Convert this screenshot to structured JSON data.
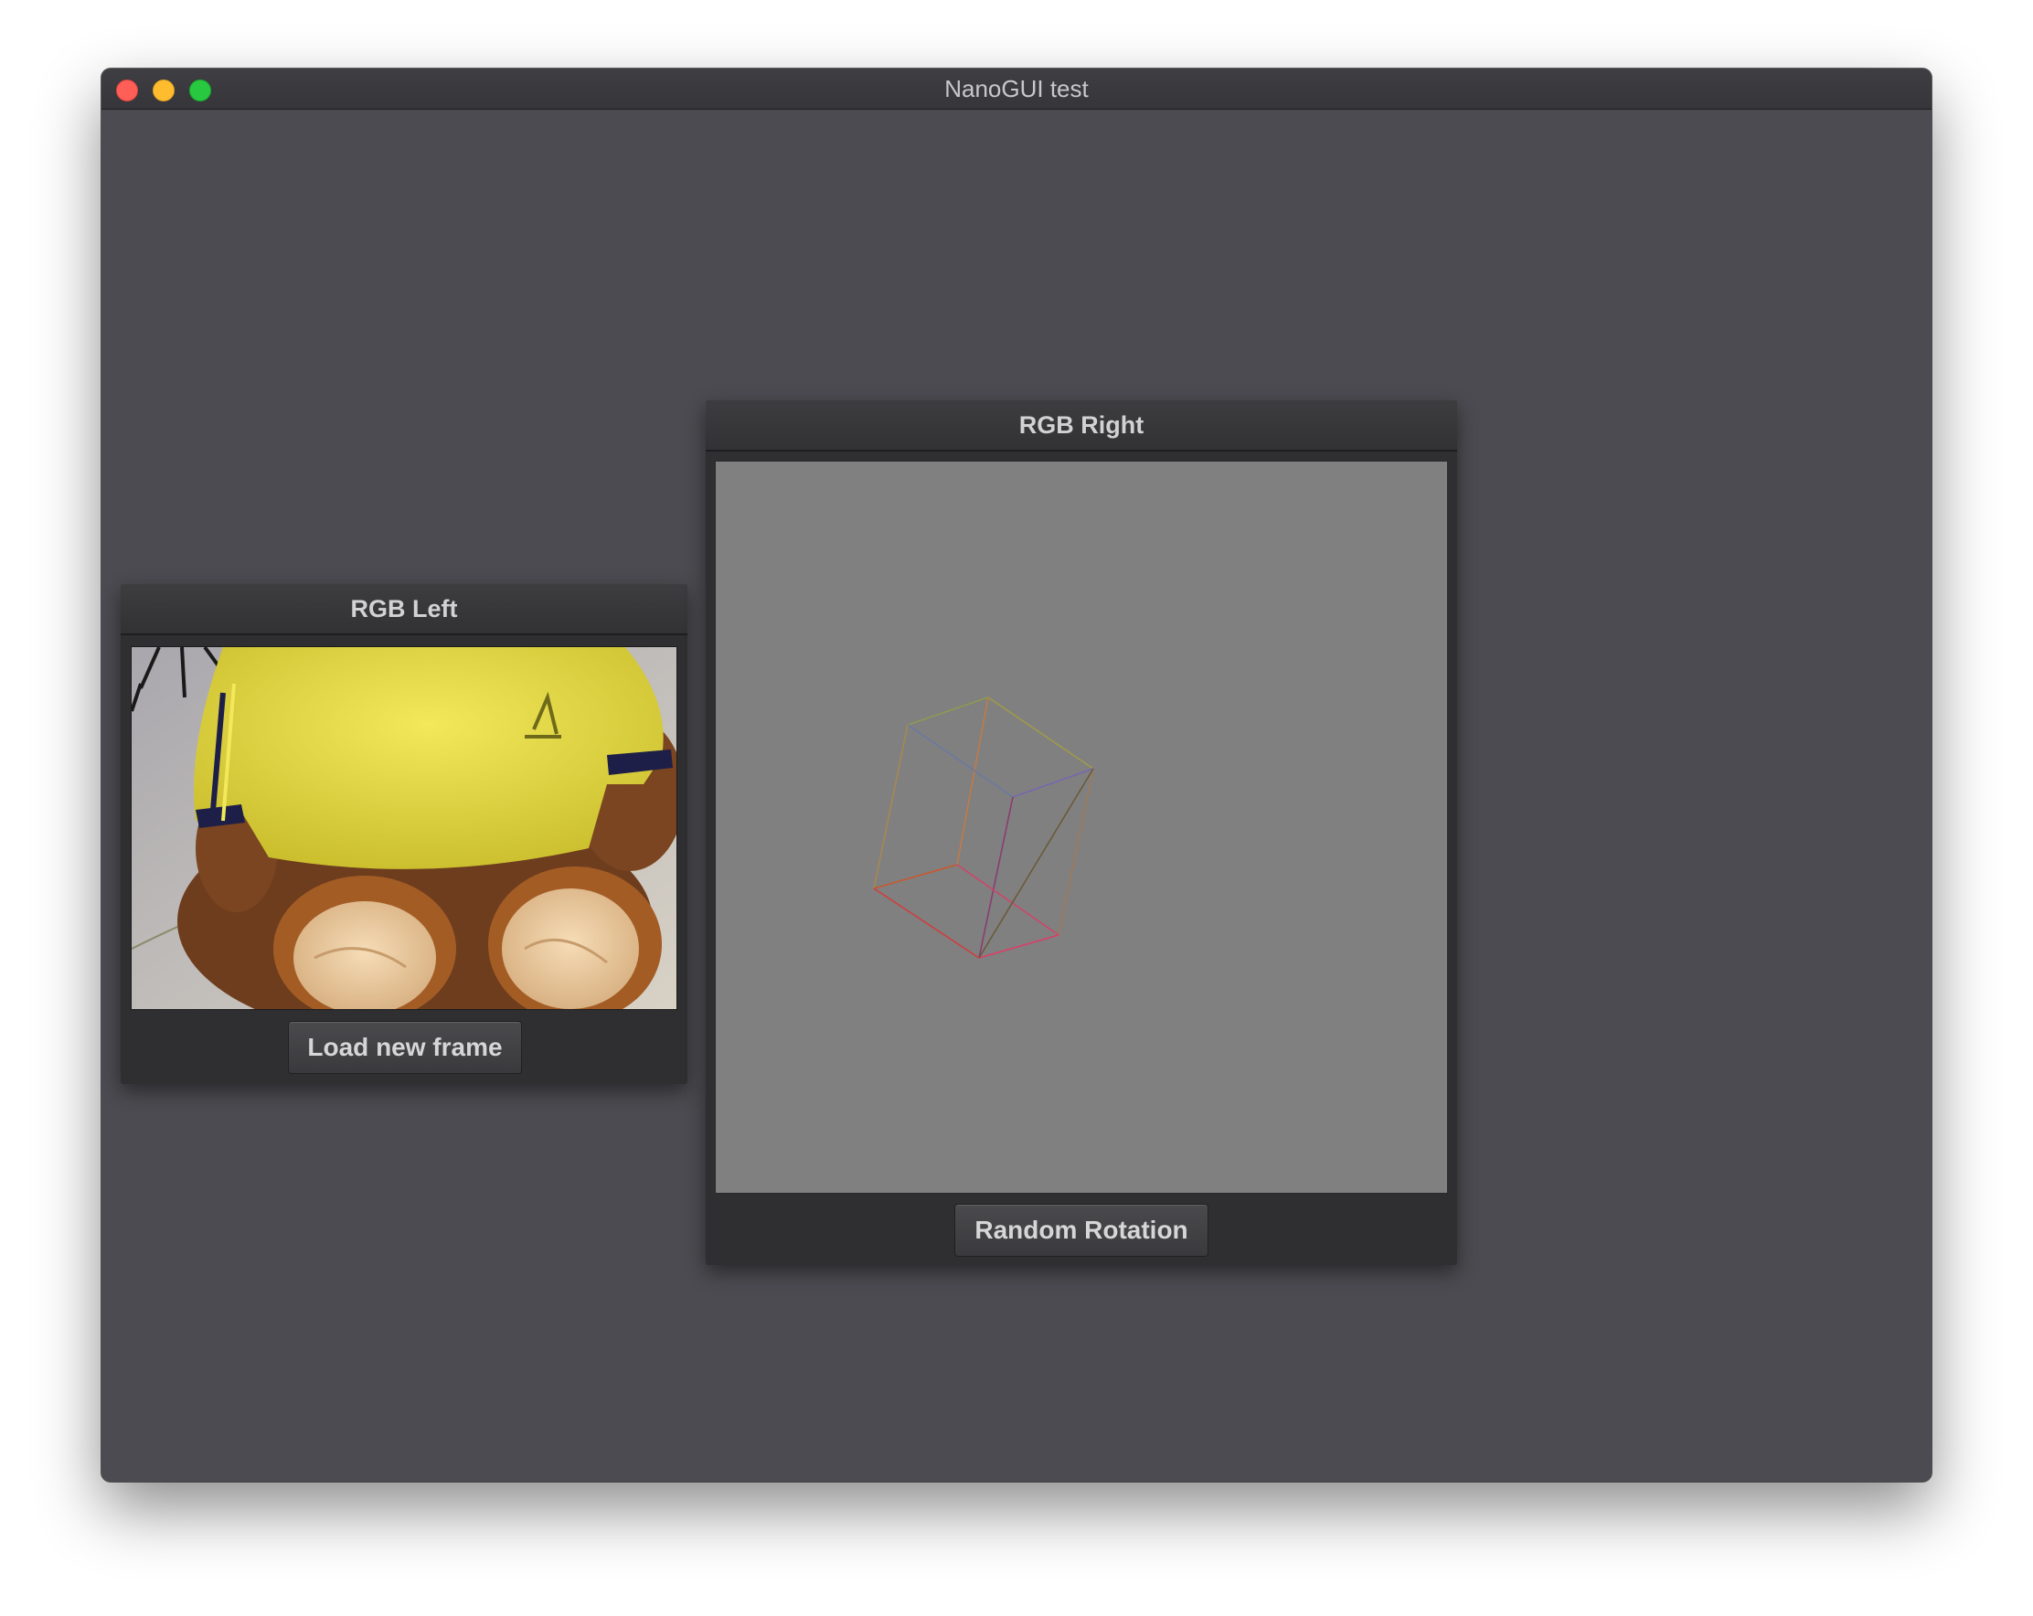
{
  "window": {
    "title": "NanoGUI test",
    "background": "#4b4b51"
  },
  "panels": {
    "left": {
      "title": "RGB Left",
      "button_label": "Load new frame",
      "image_description_icon": "teddy-bear-photo"
    },
    "right": {
      "title": "RGB Right",
      "button_label": "Random Rotation",
      "canvas_background": "#808080",
      "content_icon": "wireframe-cube"
    }
  },
  "colors": {
    "panel": "#2f2f31",
    "traffic_close": "#ff5f57",
    "traffic_minimize": "#febc2e",
    "traffic_zoom": "#28c840"
  }
}
